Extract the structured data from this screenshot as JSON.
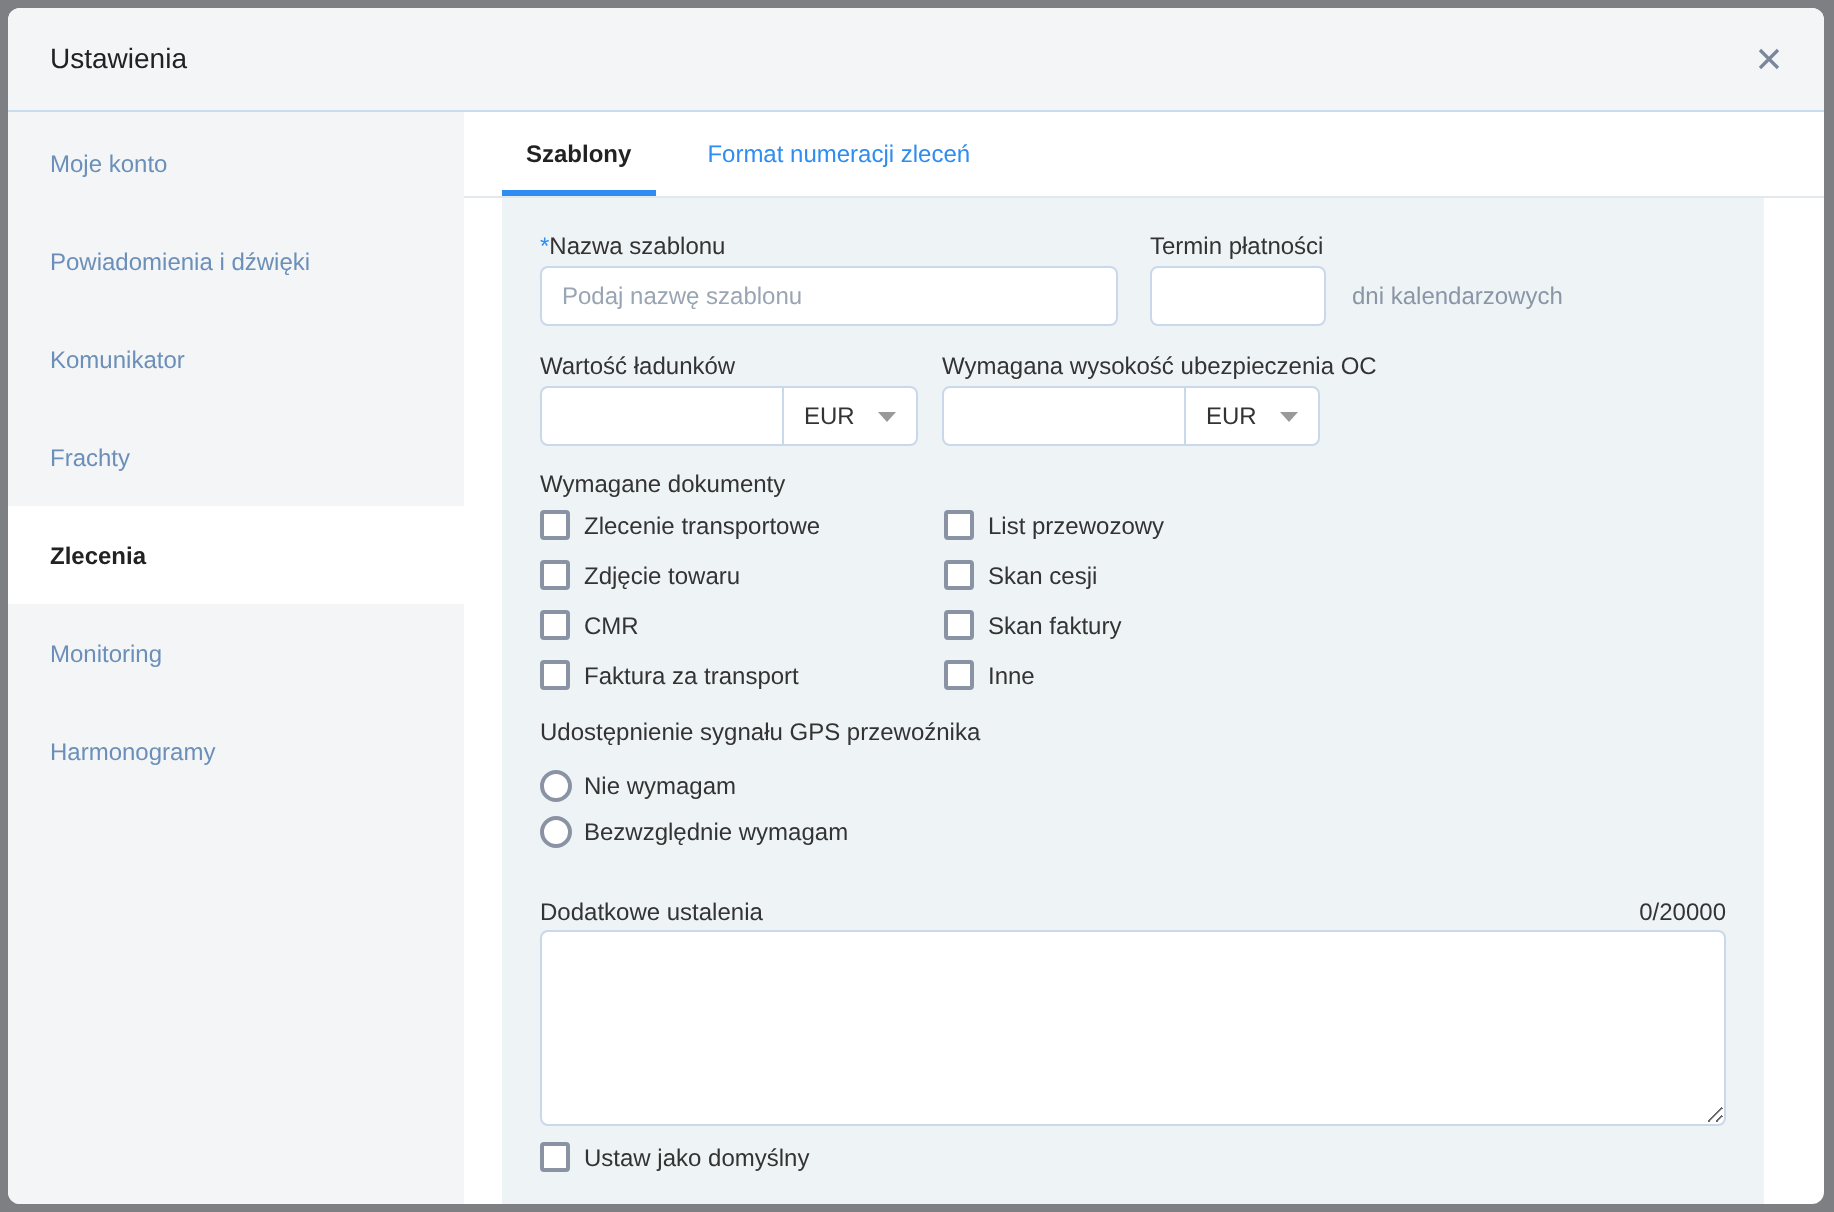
{
  "dialog": {
    "title": "Ustawienia"
  },
  "sidebar": {
    "items": [
      {
        "label": "Moje konto",
        "selected": false
      },
      {
        "label": "Powiadomienia i dźwięki",
        "selected": false
      },
      {
        "label": "Komunikator",
        "selected": false
      },
      {
        "label": "Frachty",
        "selected": false
      },
      {
        "label": "Zlecenia",
        "selected": true
      },
      {
        "label": "Monitoring",
        "selected": false
      },
      {
        "label": "Harmonogramy",
        "selected": false
      }
    ]
  },
  "tabs": [
    {
      "label": "Szablony",
      "selected": true
    },
    {
      "label": "Format numeracji zleceń",
      "selected": false
    }
  ],
  "form": {
    "template_name": {
      "label": "Nazwa szablonu",
      "required_mark": "*",
      "placeholder": "Podaj nazwę szablonu"
    },
    "payment_term": {
      "label": "Termin płatności",
      "suffix": "dni kalendarzowych"
    },
    "cargo_value": {
      "label": "Wartość ładunków",
      "currency": "EUR"
    },
    "insurance": {
      "label": "Wymagana wysokość ubezpieczenia OC",
      "currency": "EUR"
    },
    "documents": {
      "label": "Wymagane dokumenty",
      "items": [
        {
          "label": "Zlecenie transportowe",
          "checked": false
        },
        {
          "label": "List przewozowy",
          "checked": false
        },
        {
          "label": "Zdjęcie towaru",
          "checked": false
        },
        {
          "label": "Skan cesji",
          "checked": false
        },
        {
          "label": "CMR",
          "checked": false
        },
        {
          "label": "Skan faktury",
          "checked": false
        },
        {
          "label": "Faktura za transport",
          "checked": false
        },
        {
          "label": "Inne",
          "checked": false
        }
      ]
    },
    "gps": {
      "label": "Udostępnienie sygnału GPS przewoźnika",
      "options": [
        {
          "label": "Nie wymagam",
          "selected": false
        },
        {
          "label": "Bezwzględnie wymagam",
          "selected": false
        }
      ]
    },
    "notes": {
      "label": "Dodatkowe ustalenia",
      "counter": "0/20000"
    },
    "default": {
      "label": "Ustaw jako domyślny",
      "checked": false
    }
  }
}
